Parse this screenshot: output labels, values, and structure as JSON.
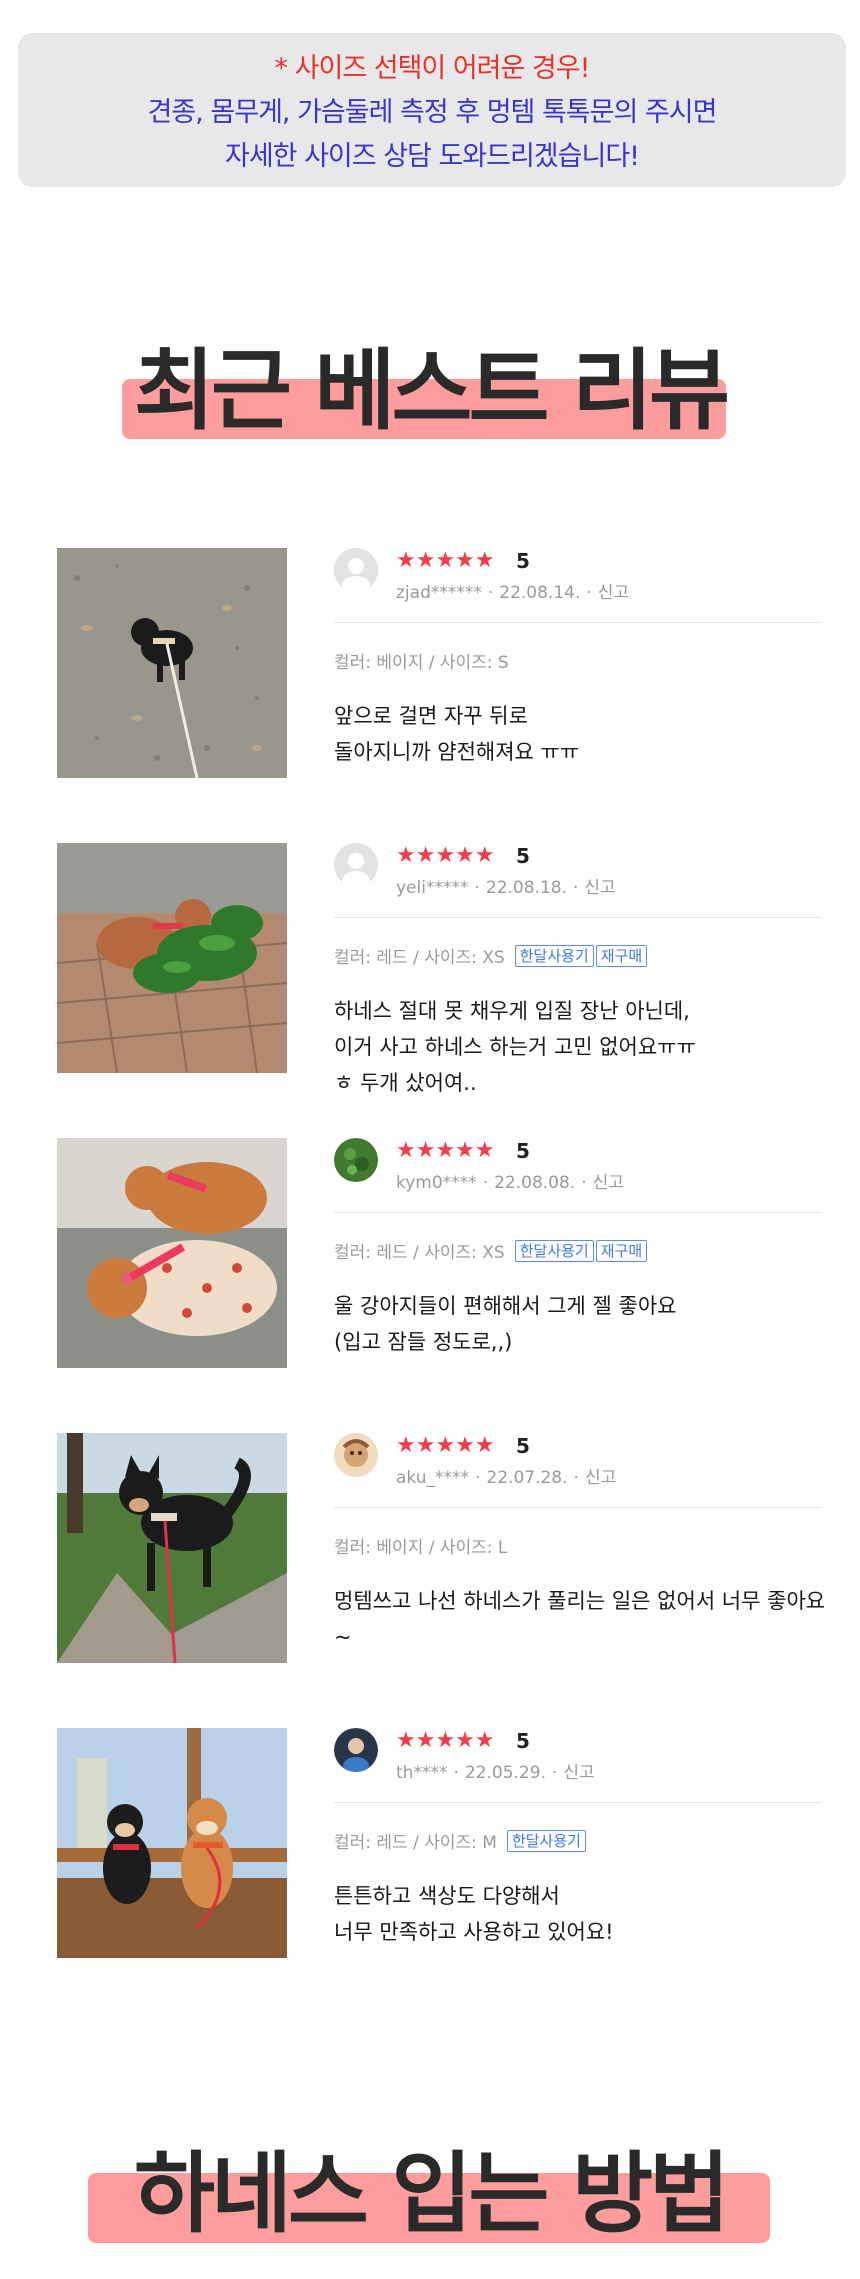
{
  "notice": {
    "line1": "*  사이즈 선택이 어려운 경우!",
    "line2": "견종, 몸무게, 가슴둘레 측정 후 멍템 톡톡문의 주시면",
    "line3": "자세한 사이즈 상담 도와드리겠습니다!"
  },
  "reviews_title": "최근 베스트 리뷰",
  "howto_title": "하네스 입는 방법",
  "report_label": "신고",
  "colors": {
    "star": "#f23d4a",
    "highlight": "#ff9c9c",
    "notice_red": "#e8332c",
    "notice_blue": "#3b35cc",
    "tag_blue": "#3f78e8"
  },
  "reviews": [
    {
      "photo": "black-puppy-on-gravel",
      "avatar": "default-avatar",
      "stars": "★★★★★",
      "score": "5",
      "user": "zjad******",
      "date": "22.08.14.",
      "option": "컬러: 베이지 / 사이즈: S",
      "tags": [],
      "text_lines": [
        "앞으로 걸면 자꾸 뒤로",
        "돌아지니까 얌전해져요 ㅠㅠ"
      ]
    },
    {
      "photo": "brown-poodle-in-grass",
      "avatar": "default-avatar",
      "stars": "★★★★★",
      "score": "5",
      "user": "yeli*****",
      "date": "22.08.18.",
      "option": "컬러: 레드 / 사이즈: XS",
      "tags": [
        "한달사용기",
        "재구매"
      ],
      "text_lines": [
        "하네스 절대 못 채우게 입질 장난 아닌데,",
        "이거 사고 하네스 하는거 고민 없어요ㅠㅠ",
        "ㅎ 두개 샀어여.."
      ]
    },
    {
      "photo": "two-poodles-sleeping",
      "avatar": "plant-avatar",
      "stars": "★★★★★",
      "score": "5",
      "user": "kym0****",
      "date": "22.08.08.",
      "option": "컬러: 레드 / 사이즈: XS",
      "tags": [
        "한달사용기",
        "재구매"
      ],
      "text_lines": [
        "울 강아지들이 편해해서 그게 젤 좋아요",
        "(입고 잠들 정도로,,)"
      ]
    },
    {
      "photo": "black-shiba-on-path",
      "avatar": "character-avatar",
      "stars": "★★★★★",
      "score": "5",
      "user": "aku_****",
      "date": "22.07.28.",
      "option": "컬러: 베이지 / 사이즈: L",
      "tags": [],
      "text_lines": [
        "멍템쓰고 나선 하네스가 풀리는 일은 없어서 너무 좋아요~"
      ]
    },
    {
      "photo": "two-shibas-in-gazebo",
      "avatar": "person-avatar",
      "stars": "★★★★★",
      "score": "5",
      "user": "th****",
      "date": "22.05.29.",
      "option": "컬러: 레드 / 사이즈: M",
      "tags": [
        "한달사용기"
      ],
      "text_lines": [
        "튼튼하고 색상도 다양해서",
        "너무 만족하고 사용하고 있어요!"
      ]
    }
  ]
}
